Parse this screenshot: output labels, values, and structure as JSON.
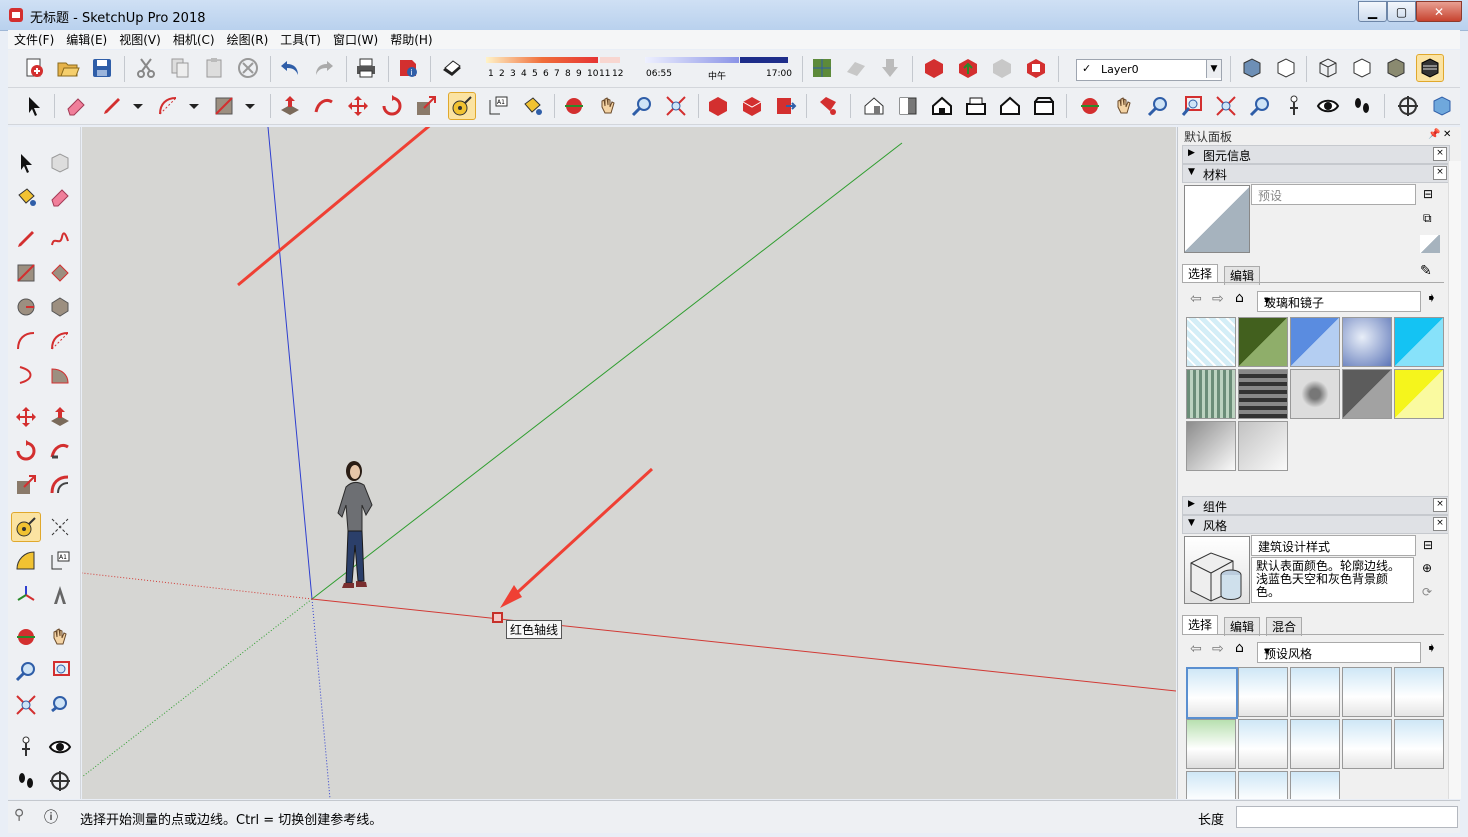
{
  "window": {
    "title": "无标题 - SketchUp Pro 2018"
  },
  "menu": [
    "文件(F)",
    "编辑(E)",
    "视图(V)",
    "相机(C)",
    "绘图(R)",
    "工具(T)",
    "窗口(W)",
    "帮助(H)"
  ],
  "shadows": {
    "months": [
      "1",
      "2",
      "3",
      "4",
      "5",
      "6",
      "7",
      "8",
      "9",
      "10",
      "11",
      "12"
    ],
    "time_start": "06:55",
    "time_mid": "中午",
    "time_end": "17:00"
  },
  "layer": {
    "current": "Layer0"
  },
  "viewport": {
    "tooltip": "红色轴线"
  },
  "status": {
    "message": "选择开始测量的点或边线。Ctrl = 切换创建参考线。",
    "length_label": "长度"
  },
  "tray": {
    "title": "默认面板",
    "entity_info": "图元信息",
    "materials": {
      "header": "材料",
      "name": "预设",
      "tab_select": "选择",
      "tab_edit": "编辑",
      "library": "玻璃和镜子"
    },
    "components": "组件",
    "styles": {
      "header": "风格",
      "name": "建筑设计样式",
      "description": "默认表面颜色。轮廓边线。浅蓝色天空和灰色背景颜色。",
      "tab_select": "选择",
      "tab_edit": "编辑",
      "tab_mix": "混合",
      "library": "预设风格"
    }
  },
  "colors": {
    "red_axis": "#d23a35",
    "green_axis": "#2f9e2f",
    "blue_axis": "#2f3fd0",
    "accent": "#fbe3a2",
    "arrow": "#ef4034"
  }
}
